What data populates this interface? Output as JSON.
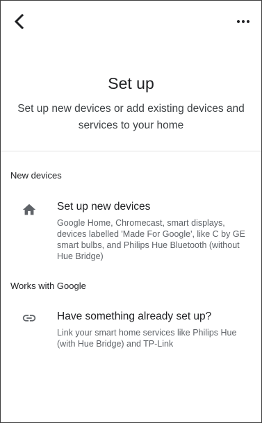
{
  "header": {
    "back_icon": "chevron-left-icon",
    "more_icon": "more-horizontal-icon"
  },
  "hero": {
    "title": "Set up",
    "subtitle": "Set up new devices or add existing devices and services to your home"
  },
  "sections": [
    {
      "label": "New devices",
      "item": {
        "icon": "home-icon",
        "title": "Set up new devices",
        "description": "Google Home, Chromecast, smart displays, devices labelled 'Made For Google', like C by GE smart bulbs, and Philips Hue Bluetooth (without Hue Bridge)"
      }
    },
    {
      "label": "Works with Google",
      "item": {
        "icon": "link-icon",
        "title": "Have something already set up?",
        "description": "Link your smart home services like Philips Hue (with Hue Bridge) and TP-Link"
      }
    }
  ],
  "colors": {
    "text_primary": "#202124",
    "text_secondary": "#5f6368",
    "icon": "#5f6368",
    "divider": "#e0e0e0"
  }
}
